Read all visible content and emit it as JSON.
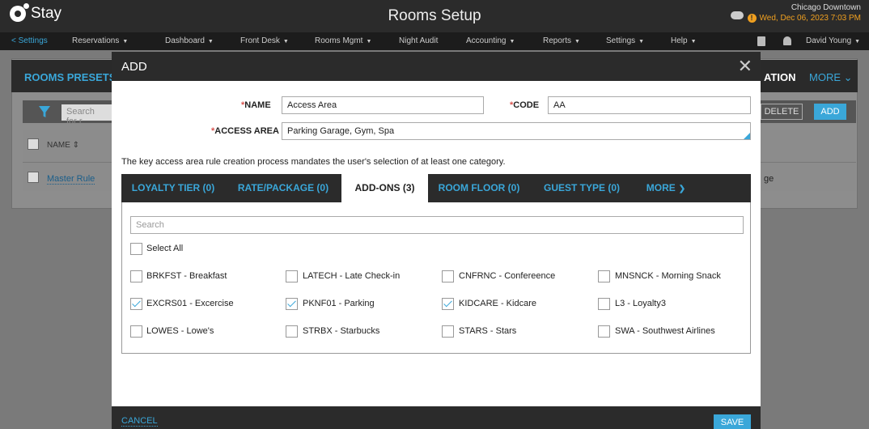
{
  "header": {
    "brand": "Stay",
    "title": "Rooms Setup",
    "hotel": "Chicago Downtown",
    "datetime": "Wed, Dec 06, 2023 7:03 PM"
  },
  "nav": {
    "back": "< Settings",
    "items": [
      "Reservations",
      "Dashboard",
      "Front Desk",
      "Rooms Mgmt",
      "Night Audit",
      "Accounting",
      "Reports",
      "Settings",
      "Help"
    ],
    "user": "David Young"
  },
  "background": {
    "tab_presets": "ROOMS PRESETS",
    "tab_partial": "ATION",
    "tab_more": "MORE",
    "search_placeholder": "Search for r",
    "delete_label": "DELETE",
    "add_label": "ADD",
    "col_name": "NAME",
    "row_link": "Master Rule",
    "row_partial": "ge"
  },
  "modal": {
    "title": "ADD",
    "name_label": "NAME",
    "name_value": "Access Area",
    "code_label": "CODE",
    "code_value": "AA",
    "access_label": "ACCESS AREA",
    "access_value": "Parking Garage, Gym, Spa",
    "note": "The key access area rule creation process mandates the user's selection of at least one category.",
    "tabs": [
      "LOYALTY TIER (0)",
      "RATE/PACKAGE (0)",
      "ADD-ONS (3)",
      "ROOM FLOOR (0)",
      "GUEST TYPE (0)",
      "MORE"
    ],
    "active_tab": "ADD-ONS (3)",
    "search_placeholder": "Search",
    "select_all": "Select All",
    "options": [
      {
        "label": "BRKFST - Breakfast",
        "checked": false
      },
      {
        "label": "LATECH - Late Check-in",
        "checked": false
      },
      {
        "label": "CNFRNC - Confereence",
        "checked": false
      },
      {
        "label": "MNSNCK - Morning Snack",
        "checked": false
      },
      {
        "label": "EXCRS01 - Excercise",
        "checked": true
      },
      {
        "label": "PKNF01 - Parking",
        "checked": true
      },
      {
        "label": "KIDCARE - Kidcare",
        "checked": true
      },
      {
        "label": "L3 - Loyalty3",
        "checked": false
      },
      {
        "label": "LOWES - Lowe's",
        "checked": false
      },
      {
        "label": "STRBX - Starbucks",
        "checked": false
      },
      {
        "label": "STARS - Stars",
        "checked": false
      },
      {
        "label": "SWA - Southwest Airlines",
        "checked": false
      }
    ],
    "cancel": "CANCEL",
    "save": "SAVE"
  },
  "colors": {
    "accent": "#3aa7d9",
    "dark": "#2b2b2b",
    "warning": "#f0a020"
  }
}
